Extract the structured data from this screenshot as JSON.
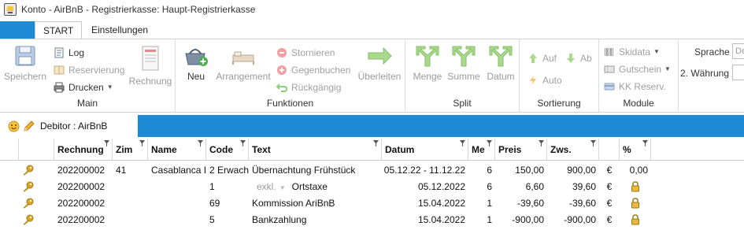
{
  "window": {
    "title": "Konto - AirBnB  - Registrierkasse: Haupt-Registrierkasse"
  },
  "tabs": {
    "start": "START",
    "settings": "Einstellungen"
  },
  "ribbon": {
    "speichern": "Speichern",
    "log": "Log",
    "reservierung": "Reservierung",
    "drucken": "Drucken",
    "rechnung": "Rechnung",
    "main_label": "Main",
    "neu": "Neu",
    "arrangement": "Arrangement",
    "stornieren": "Stornieren",
    "gegenbuchen": "Gegenbuchen",
    "rueckgaengig": "Rückgängig",
    "ueberleiten": "Überleiten",
    "funktionen_label": "Funktionen",
    "menge": "Menge",
    "summe": "Summe",
    "datum": "Datum",
    "split_label": "Split",
    "auf": "Auf",
    "ab": "Ab",
    "auto": "Auto",
    "sortierung_label": "Sortierung",
    "skidata": "Skidata",
    "gutschein": "Gutschein",
    "kk_reserv": "KK Reserv.",
    "module_label": "Module",
    "sprache": "Sprache",
    "sprache_value": "De",
    "waehrung": "2. Währung"
  },
  "debitor": {
    "label": "Debitor :  AirBnB"
  },
  "table": {
    "headers": {
      "rechnung": "Rechnung",
      "zim": "Zim",
      "name": "Name",
      "code": "Code",
      "text": "Text",
      "datum": "Datum",
      "me": "Me",
      "preis": "Preis",
      "zws": "Zws.",
      "pct": "%"
    },
    "rows": [
      {
        "rechnung": "202200002",
        "zim": "41",
        "name": "Casablanca I",
        "code": "2 Erwach",
        "text": "Übernachtung Frühstück",
        "text_prefix": "",
        "datum": "05.12.22 - 11.12.22",
        "me": "6",
        "preis": "150,00",
        "zws": "900,00",
        "cur": "€",
        "pct": "0,00",
        "locked": false
      },
      {
        "rechnung": "202200002",
        "zim": "",
        "name": "",
        "code": "1",
        "text": "Ortstaxe",
        "text_prefix": "exkl.",
        "datum": "05.12.2022",
        "me": "6",
        "preis": "6,60",
        "zws": "39,60",
        "cur": "€",
        "pct": "",
        "locked": true
      },
      {
        "rechnung": "202200002",
        "zim": "",
        "name": "",
        "code": "69",
        "text": "Kommission AriBnB",
        "text_prefix": "",
        "datum": "15.04.2022",
        "me": "1",
        "preis": "-39,60",
        "zws": "-39,60",
        "cur": "€",
        "pct": "",
        "locked": true
      },
      {
        "rechnung": "202200002",
        "zim": "",
        "name": "",
        "code": "5",
        "text": "Bankzahlung",
        "text_prefix": "",
        "datum": "15.04.2022",
        "me": "1",
        "preis": "-900,00",
        "zws": "-900,00",
        "cur": "€",
        "pct": "",
        "locked": true
      }
    ]
  },
  "colors": {
    "accent": "#1e8ad6",
    "key": "#d9a526",
    "green": "#7cc36a"
  },
  "icons": [
    "app-icon",
    "save-icon",
    "log-icon",
    "reservation-icon",
    "printer-icon",
    "invoice-icon",
    "basket-add-icon",
    "bed-icon",
    "cancel-icon",
    "counter-booking-icon",
    "undo-icon",
    "arrow-right-icon",
    "split-arrow-icon",
    "arrow-up-icon",
    "arrow-down-icon",
    "lightning-icon",
    "barcode-icon",
    "voucher-icon",
    "card-icon",
    "smiley-icon",
    "pencil-icon",
    "filter-icon",
    "key-icon",
    "lock-icon"
  ]
}
